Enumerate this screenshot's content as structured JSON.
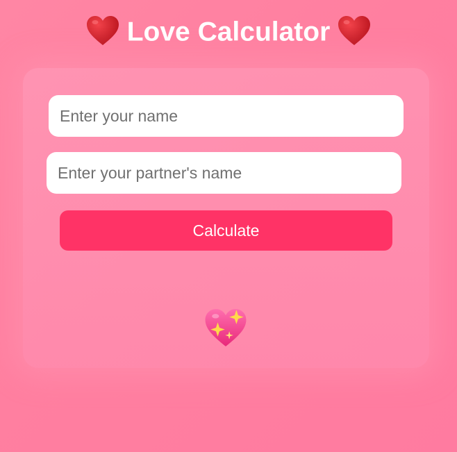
{
  "header": {
    "title": "Love Calculator",
    "left_icon": "red-heart-icon",
    "right_icon": "red-heart-icon"
  },
  "form": {
    "name_placeholder": "Enter your name",
    "name_value": "",
    "partner_placeholder": "Enter your partner's name",
    "partner_value": "",
    "calculate_label": "Calculate"
  },
  "result": {
    "icon": "sparkling-heart-icon"
  },
  "colors": {
    "background": "#ff80a2",
    "button": "#ff3366",
    "title_text": "#ffffff",
    "heart_red": "#d9232d"
  }
}
